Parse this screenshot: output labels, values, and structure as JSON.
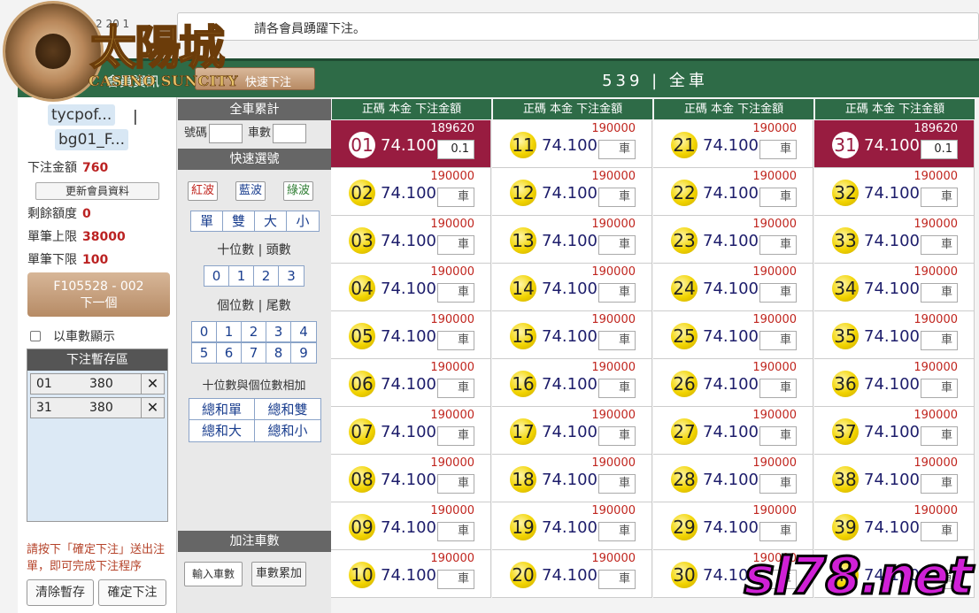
{
  "announcement": "請各會員踴躍下注。",
  "date_fragment": "2  20  1",
  "logo": {
    "cn": "太陽城",
    "en": "CASINO SUNCITY"
  },
  "header": {
    "member_info": "會員資訊",
    "quick_bet": "快速下注",
    "game_title": "539 | 全車"
  },
  "user": {
    "name1": "tycpof...",
    "sep": "|",
    "name2": "bg01_F..."
  },
  "account": {
    "bet_amount_label": "下注金額",
    "bet_amount": "760",
    "update_button": "更新會員資料",
    "remaining_label": "剩餘額度",
    "remaining": "0",
    "max_label": "單筆上限",
    "max": "38000",
    "min_label": "單筆下限",
    "min": "100"
  },
  "next_button": {
    "line1": "F105528 - 002",
    "line2": "下一個"
  },
  "show_by_car": "以車數顯示",
  "staging": {
    "title": "下注暫存區",
    "rows": [
      {
        "num": "01",
        "val": "380"
      },
      {
        "num": "31",
        "val": "380"
      }
    ],
    "remove_icon": "close-icon"
  },
  "hint": "請按下「確定下注」送出注單，即可完成下注程序",
  "buttons": {
    "clear": "清除暫存",
    "confirm": "確定下注"
  },
  "middle": {
    "total_header": "全車累計",
    "number_label": "號碼",
    "cars_label": "車數",
    "quick_header": "快速選號",
    "waves": [
      "紅波",
      "藍波",
      "綠波"
    ],
    "wave_colors": [
      "#c0251e",
      "#1b3f8f",
      "#2e7d32"
    ],
    "parity": [
      "單",
      "雙",
      "大",
      "小"
    ],
    "tens_label": "十位數 | 頭數",
    "tens": [
      "0",
      "1",
      "2",
      "3"
    ],
    "units_label": "個位數 | 尾數",
    "units_row1": [
      "0",
      "1",
      "2",
      "3",
      "4"
    ],
    "units_row2": [
      "5",
      "6",
      "7",
      "8",
      "9"
    ],
    "sum_label": "十位數與個位數相加",
    "sum_row1": [
      "總和單",
      "總和雙"
    ],
    "sum_row2": [
      "總和大",
      "總和小"
    ],
    "add_header": "加注車數",
    "input_cars": "輸入車數",
    "accum_cars": "車數累加"
  },
  "grid": {
    "col_header": "正碼  本金  下注金額",
    "odds": "74.100",
    "unit_placeholder": "車",
    "selected_color": "#981c40",
    "columns": [
      {
        "start": 1,
        "amounts": [
          "189620",
          "190000",
          "190000",
          "190000",
          "190000",
          "190000",
          "190000",
          "190000",
          "190000",
          "190000"
        ]
      },
      {
        "start": 11,
        "amounts": [
          "190000",
          "190000",
          "190000",
          "190000",
          "190000",
          "190000",
          "190000",
          "190000",
          "190000",
          "190000"
        ]
      },
      {
        "start": 21,
        "amounts": [
          "190000",
          "190000",
          "190000",
          "190000",
          "190000",
          "190000",
          "190000",
          "190000",
          "190000",
          "190000"
        ]
      },
      {
        "start": 31,
        "amounts": [
          "189620",
          "190000",
          "190000",
          "190000",
          "190000",
          "190000",
          "190000",
          "190000",
          "190000",
          ""
        ]
      }
    ],
    "selected": [
      "01",
      "31"
    ],
    "selected_value": "0.1"
  },
  "watermark": "sl78.net"
}
